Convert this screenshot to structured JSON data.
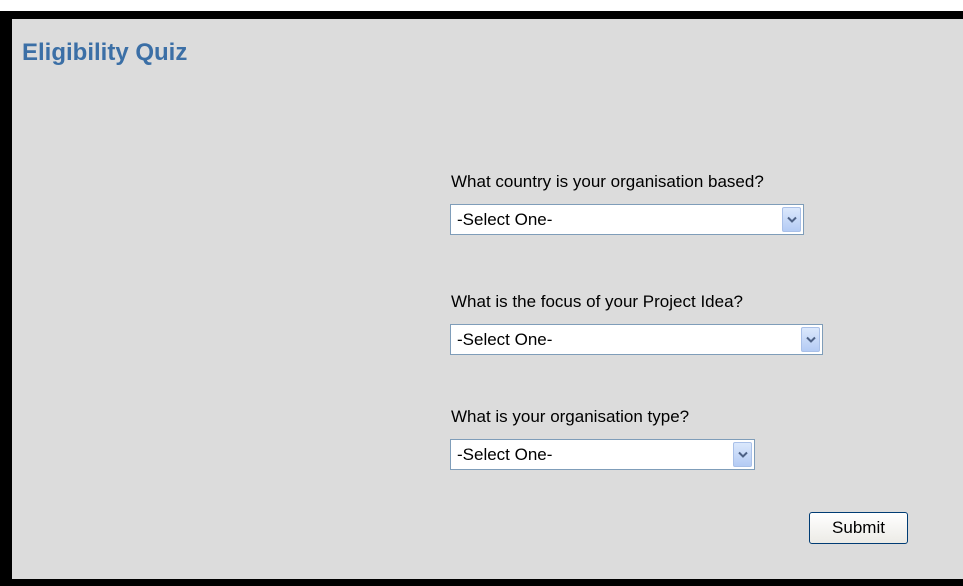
{
  "page": {
    "title": "Eligibility Quiz"
  },
  "questions": [
    {
      "label": "What country is your organisation based?",
      "selected": "-Select One-"
    },
    {
      "label": "What is the focus of your Project Idea?",
      "selected": "-Select One-"
    },
    {
      "label": "What is your organisation type?",
      "selected": "-Select One-"
    }
  ],
  "form": {
    "submit_label": "Submit"
  },
  "icons": {
    "dropdown": "chevron-down-icon"
  },
  "colors": {
    "title": "#3b6fa6",
    "panel_background": "#dcdcdc",
    "frame": "#000000"
  }
}
